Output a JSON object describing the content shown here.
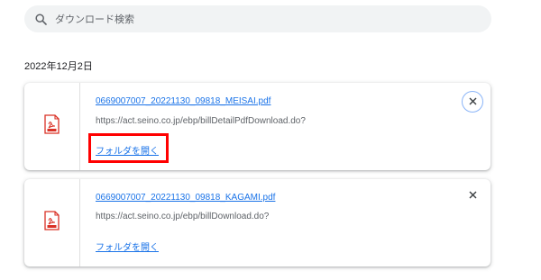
{
  "search": {
    "placeholder": "ダウンロード検索",
    "icon": "search-icon"
  },
  "date_group": {
    "label": "2022年12月2日"
  },
  "downloads": [
    {
      "filename": "0669007007_20221130_09818_MEISAI.pdf",
      "url": "https://act.seino.co.jp/ebp/billDetailPdfDownload.do?",
      "folder_link": "フォルダを開く",
      "icon": "pdf-file-icon",
      "close_focused": true,
      "highlighted": true
    },
    {
      "filename": "0669007007_20221130_09818_KAGAMI.pdf",
      "url": "https://act.seino.co.jp/ebp/billDownload.do?",
      "folder_link": "フォルダを開く",
      "icon": "pdf-file-icon",
      "close_focused": false,
      "highlighted": false
    }
  ],
  "colors": {
    "link": "#1a73e8",
    "pdf_red": "#d93025",
    "highlight": "#ff0000",
    "focus_ring": "#8ab4f8"
  }
}
